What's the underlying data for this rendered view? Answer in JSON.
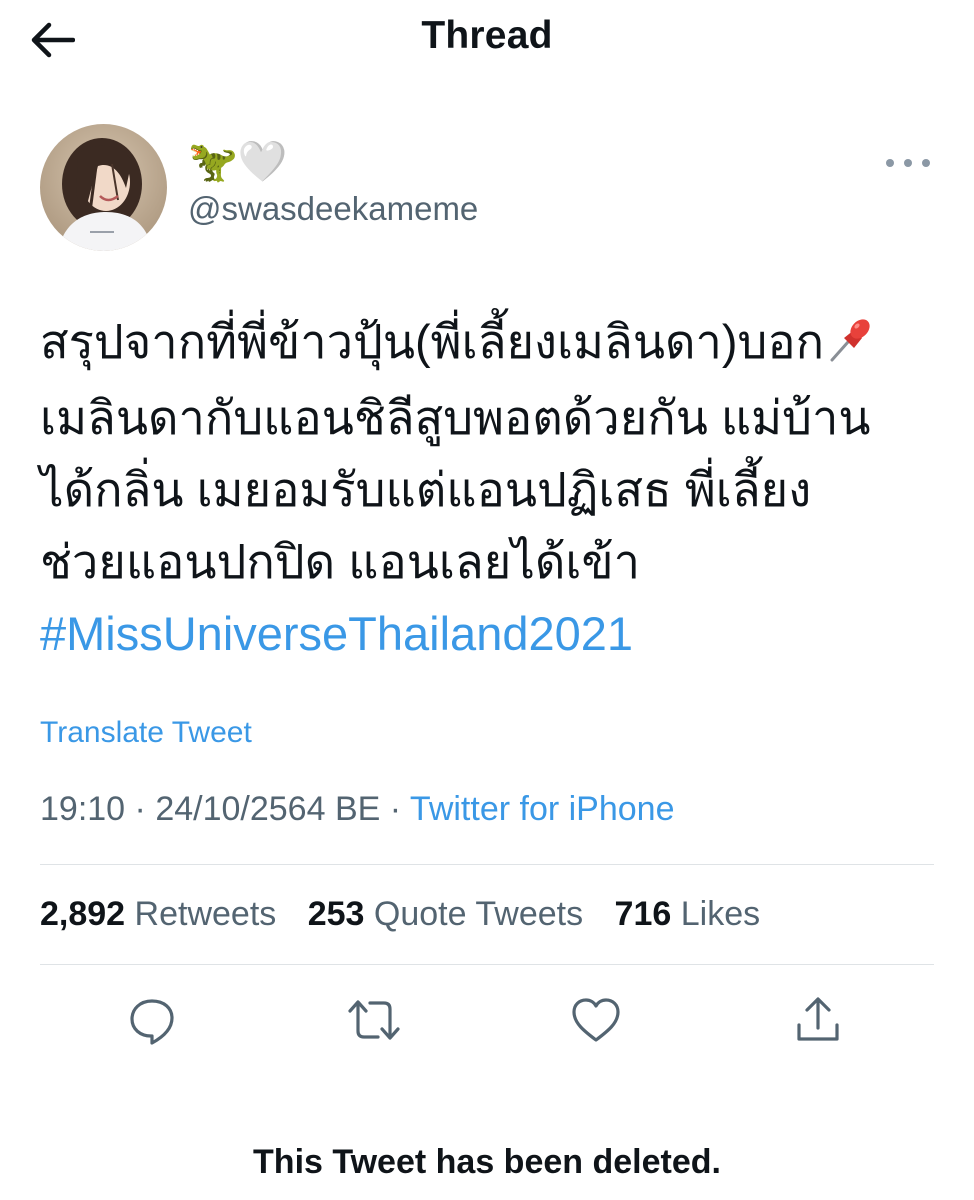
{
  "header": {
    "title": "Thread",
    "back_icon": "arrow-left-icon"
  },
  "author": {
    "display_name": "🦖🤍",
    "handle": "@swasdeekameme",
    "more_icon": "more-horizontal-icon"
  },
  "tweet": {
    "lines": [
      "สรุปจากที่พี่ข้าวปุ้น(พี่เลี้ยงเมลินดา)บอก",
      "เมลินดากับแอนชิลีสูบพอตด้วยกัน แม่บ้าน",
      "ได้กลิ่น เมยอมรับแต่แอนปฏิเสธ พี่เลี้ยง",
      "ช่วยแอนปกปิด แอนเลยได้เข้า"
    ],
    "hashtag": "#MissUniverseThailand2021",
    "translate": "Translate Tweet",
    "time": "19:10",
    "date": "24/10/2564 BE",
    "separator": "·",
    "source": "Twitter for iPhone"
  },
  "stats": {
    "retweets": {
      "count": "2,892",
      "label": "Retweets"
    },
    "quotes": {
      "count": "253",
      "label": "Quote Tweets"
    },
    "likes": {
      "count": "716",
      "label": "Likes"
    }
  },
  "actions": [
    "reply-icon",
    "retweet-icon",
    "like-icon",
    "share-icon"
  ],
  "footer": {
    "deleted_notice": "This Tweet has been deleted."
  },
  "colors": {
    "accent": "#3a98e6",
    "muted": "#536471",
    "text": "#0f1419",
    "divider": "#dfe3e6"
  }
}
